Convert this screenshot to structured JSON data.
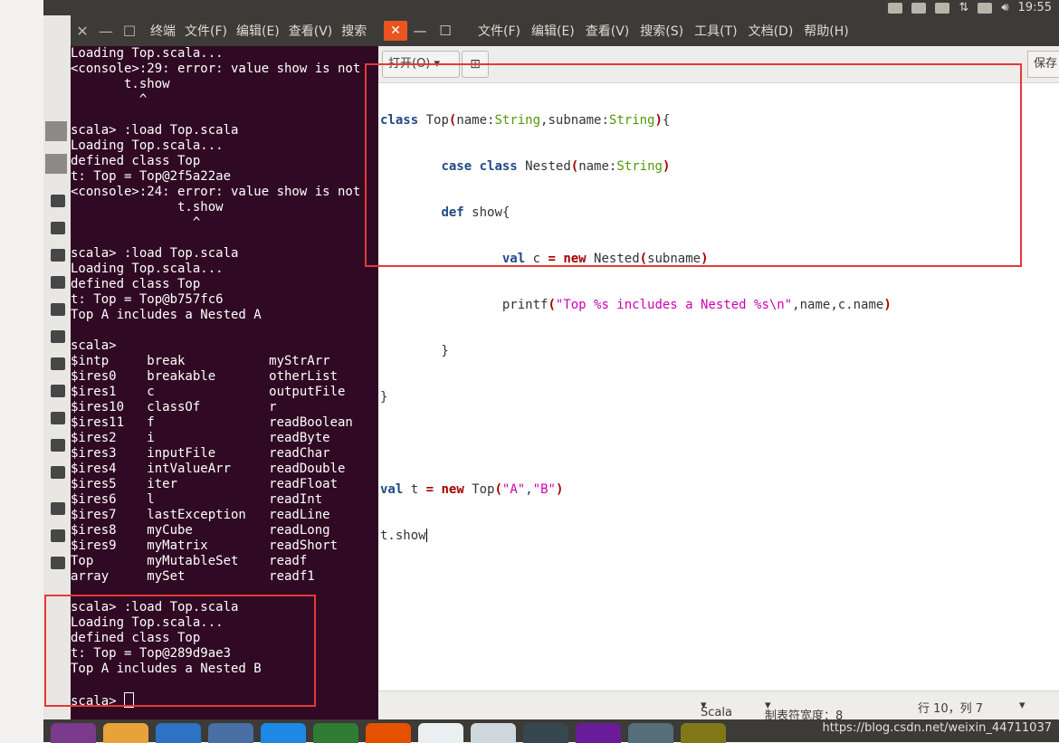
{
  "system_tray": {
    "time": "19:55"
  },
  "terminal": {
    "title": "终端",
    "menus": [
      "文件(F)",
      "编辑(E)",
      "查看(V)",
      "搜索"
    ],
    "lines": [
      "Loading Top.scala...",
      "<console>:29: error: value show is not",
      "       t.show",
      "         ^",
      "",
      "scala> :load Top.scala",
      "Loading Top.scala...",
      "defined class Top",
      "t: Top = Top@2f5a22ae",
      "<console>:24: error: value show is not",
      "              t.show",
      "                ^",
      "",
      "scala> :load Top.scala",
      "Loading Top.scala...",
      "defined class Top",
      "t: Top = Top@b757fc6",
      "Top A includes a Nested A",
      "",
      "scala>",
      "$intp     break           myStrArr",
      "$ires0    breakable       otherList",
      "$ires1    c               outputFile",
      "$ires10   classOf         r",
      "$ires11   f               readBoolean",
      "$ires2    i               readByte",
      "$ires3    inputFile       readChar",
      "$ires4    intValueArr     readDouble",
      "$ires5    iter            readFloat",
      "$ires6    l               readInt",
      "$ires7    lastException   readLine",
      "$ires8    myCube          readLong",
      "$ires9    myMatrix        readShort",
      "Top       myMutableSet    readf",
      "array     mySet           readf1",
      "",
      "scala> :load Top.scala",
      "Loading Top.scala...",
      "defined class Top",
      "t: Top = Top@289d9ae3",
      "Top A includes a Nested B",
      ""
    ],
    "prompt": "scala> "
  },
  "editor": {
    "menus": [
      "文件(F)",
      "编辑(E)",
      "查看(V)",
      "搜索(S)",
      "工具(T)",
      "文档(D)",
      "帮助(H)"
    ],
    "open_label": "打开(O)",
    "save_label": "保存",
    "status": {
      "language": "Scala",
      "tab_width": "制表符宽度：8",
      "position": "行 10，列 7"
    }
  },
  "watermark": "https://blog.csdn.net/weixin_44711037"
}
